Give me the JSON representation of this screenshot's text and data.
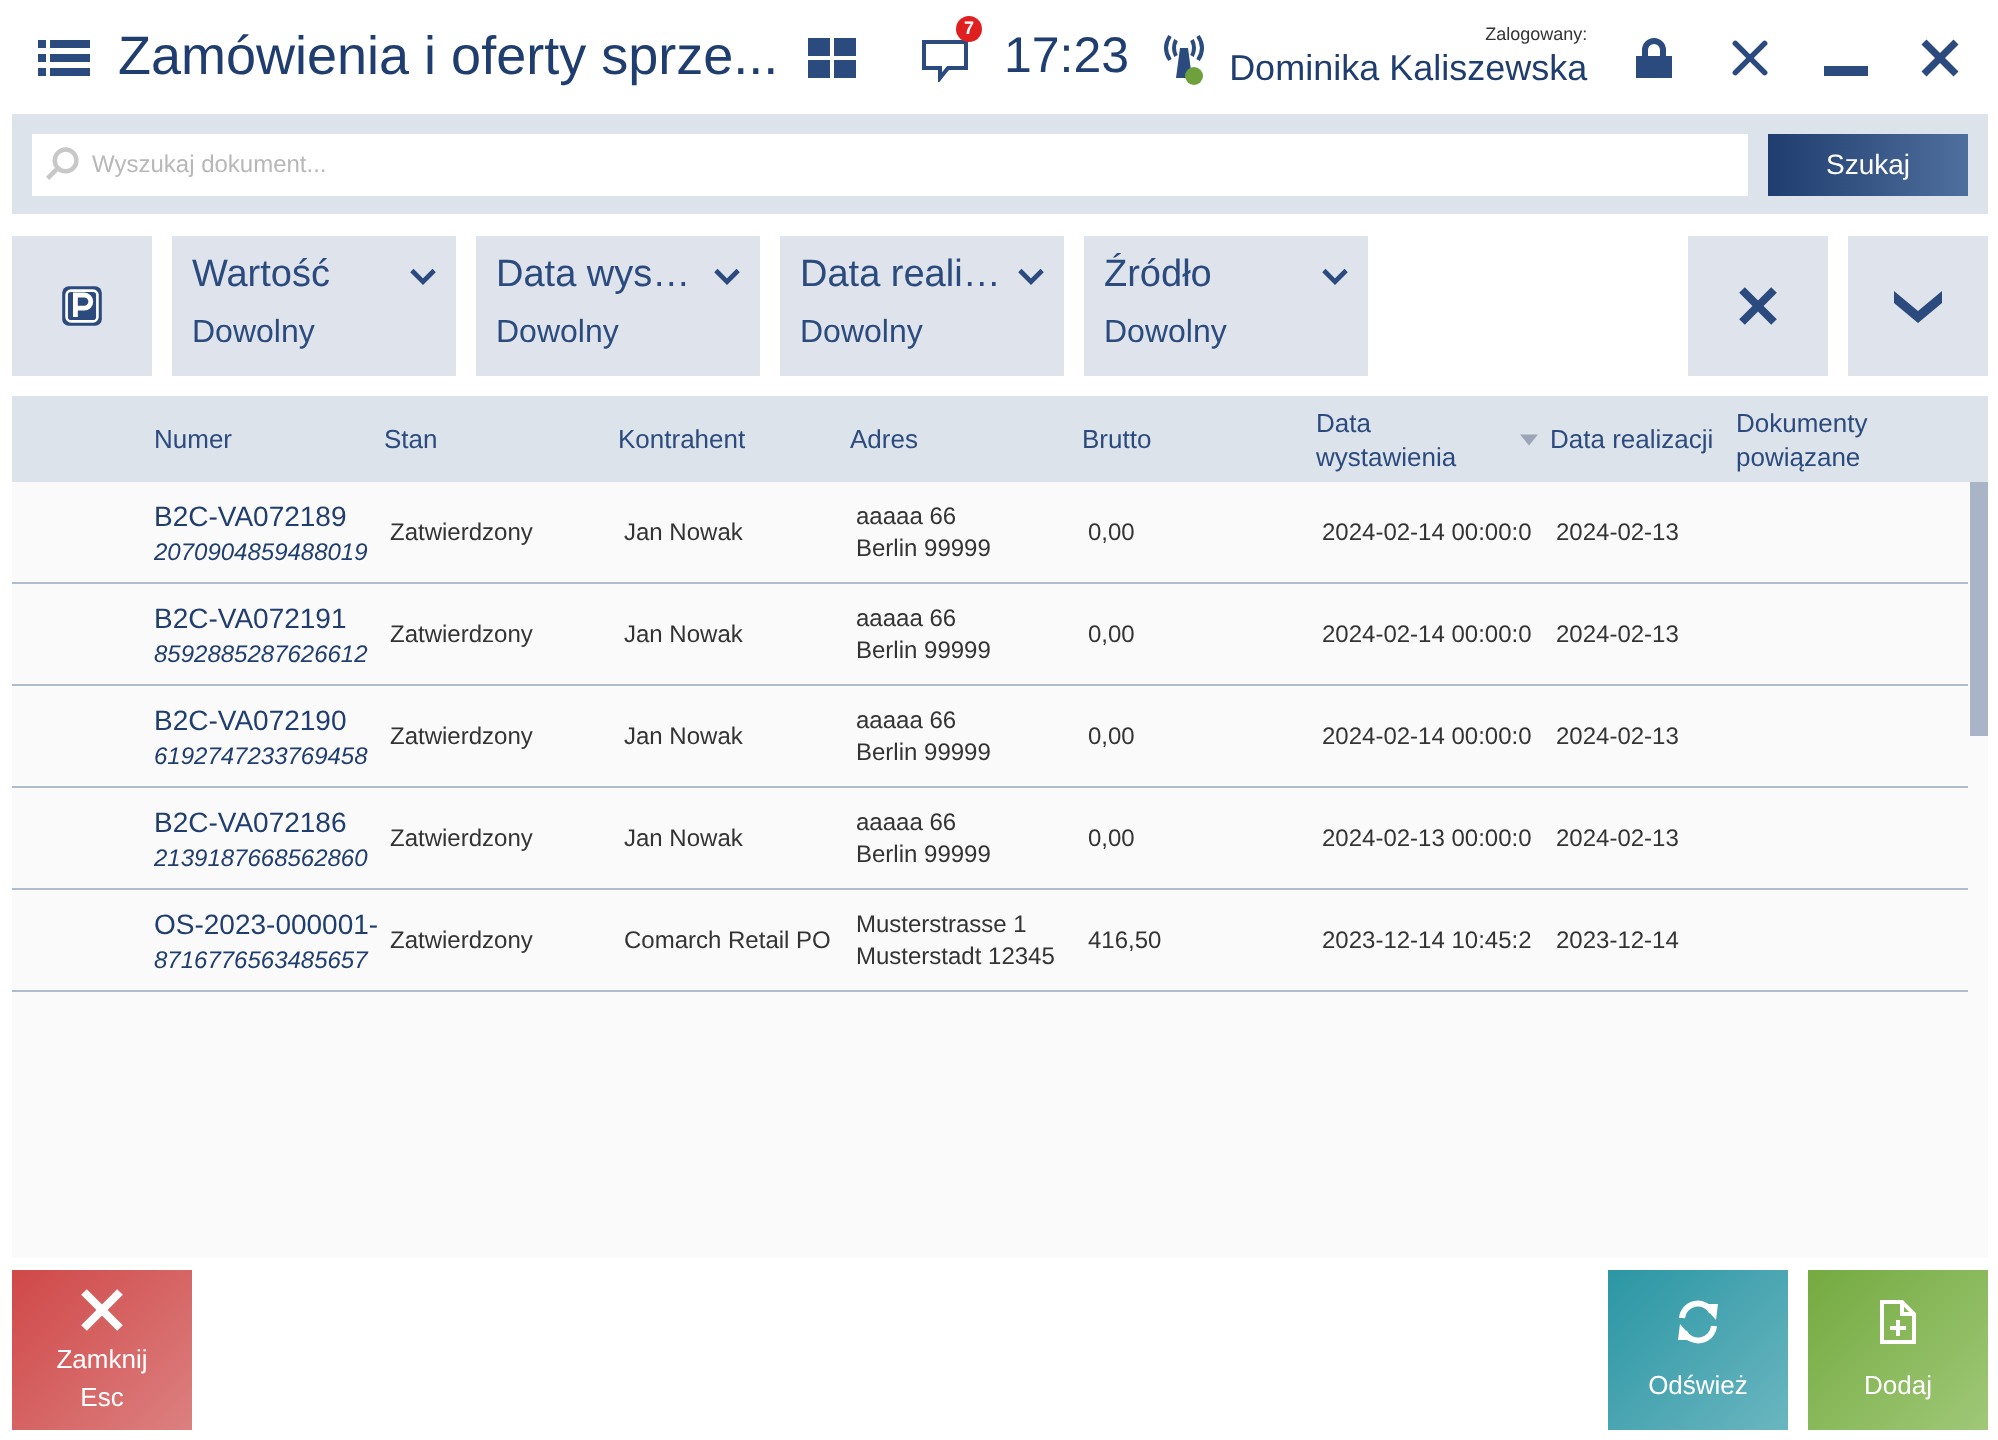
{
  "window": {
    "title": "Zamówienia i oferty sprze...",
    "time": "17:23",
    "notifications": "7",
    "user_label": "Zalogowany:",
    "user": "Dominika Kaliszewska"
  },
  "search": {
    "placeholder": "Wyszukaj dokument...",
    "button": "Szukaj"
  },
  "filters": [
    {
      "label": "Wartość",
      "value": "Dowolny"
    },
    {
      "label": "Data wys…",
      "value": "Dowolny"
    },
    {
      "label": "Data reali…",
      "value": "Dowolny"
    },
    {
      "label": "Źródło",
      "value": "Dowolny"
    }
  ],
  "table": {
    "columns": [
      {
        "label": "Numer",
        "sorted": false
      },
      {
        "label": "Stan",
        "sorted": false
      },
      {
        "label": "Kontrahent",
        "sorted": false
      },
      {
        "label": "Adres",
        "sorted": false
      },
      {
        "label": "Brutto",
        "sorted": false
      },
      {
        "label": "Data wystawienia",
        "sorted": true
      },
      {
        "label": "Data realizacji",
        "sorted": false
      },
      {
        "label": "Dokumenty powiązane",
        "sorted": false
      }
    ],
    "rows": [
      {
        "number": "B2C-VA072189",
        "code": "2070904859488019",
        "status": "Zatwierdzony",
        "contractor": "Jan Nowak",
        "address": [
          "aaaaa 66",
          "Berlin 99999"
        ],
        "gross": "0,00",
        "issue_date": "2024-02-14 00:00:0",
        "completion_date": "2024-02-13"
      },
      {
        "number": "B2C-VA072191",
        "code": "8592885287626612",
        "status": "Zatwierdzony",
        "contractor": "Jan Nowak",
        "address": [
          "aaaaa 66",
          "Berlin 99999"
        ],
        "gross": "0,00",
        "issue_date": "2024-02-14 00:00:0",
        "completion_date": "2024-02-13"
      },
      {
        "number": "B2C-VA072190",
        "code": "6192747233769458",
        "status": "Zatwierdzony",
        "contractor": "Jan Nowak",
        "address": [
          "aaaaa 66",
          "Berlin 99999"
        ],
        "gross": "0,00",
        "issue_date": "2024-02-14 00:00:0",
        "completion_date": "2024-02-13"
      },
      {
        "number": "B2C-VA072186",
        "code": "2139187668562860",
        "status": "Zatwierdzony",
        "contractor": "Jan Nowak",
        "address": [
          "aaaaa 66",
          "Berlin 99999"
        ],
        "gross": "0,00",
        "issue_date": "2024-02-13 00:00:0",
        "completion_date": "2024-02-13"
      },
      {
        "number": "OS-2023-000001-",
        "code": "8716776563485657",
        "status": "Zatwierdzony",
        "contractor": "Comarch Retail PO",
        "address": [
          "Musterstrasse 1",
          "Musterstadt 12345"
        ],
        "gross": "416,50",
        "issue_date": "2023-12-14 10:45:2",
        "completion_date": "2023-12-14"
      }
    ]
  },
  "actions": [
    {
      "kind": "close",
      "label": "Zamknij",
      "hotkey": "Esc"
    },
    {
      "kind": "refresh",
      "label": "Odśwież"
    },
    {
      "kind": "add",
      "label": "Dodaj"
    }
  ]
}
